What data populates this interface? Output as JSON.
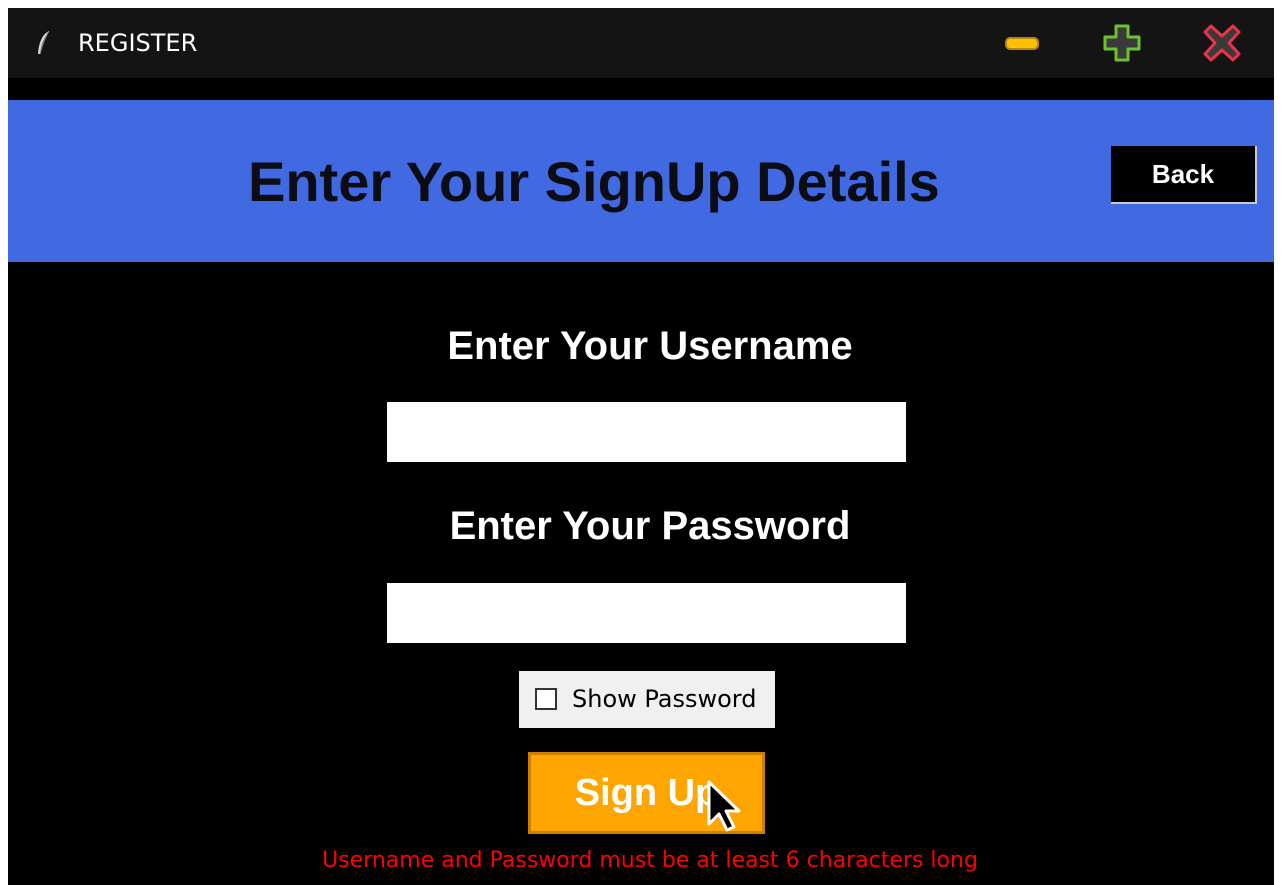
{
  "window": {
    "title": "REGISTER",
    "app_icon": "feather-icon",
    "controls": {
      "minimize_icon": "minimize-icon",
      "maximize_icon": "plus-icon",
      "close_icon": "close-x-icon"
    }
  },
  "header": {
    "title": "Enter Your SignUp Details",
    "back_label": "Back",
    "background": "#4169e1"
  },
  "form": {
    "username_label": "Enter Your Username",
    "username_value": "",
    "password_label": "Enter Your Password",
    "password_value": "",
    "show_password_label": "Show Password",
    "show_password_checked": false,
    "signup_label": "Sign Up",
    "error_message": "Username and Password must be at least 6 characters long"
  },
  "colors": {
    "accent": "#ffa500",
    "error": "#ff0000",
    "background": "#000000"
  }
}
